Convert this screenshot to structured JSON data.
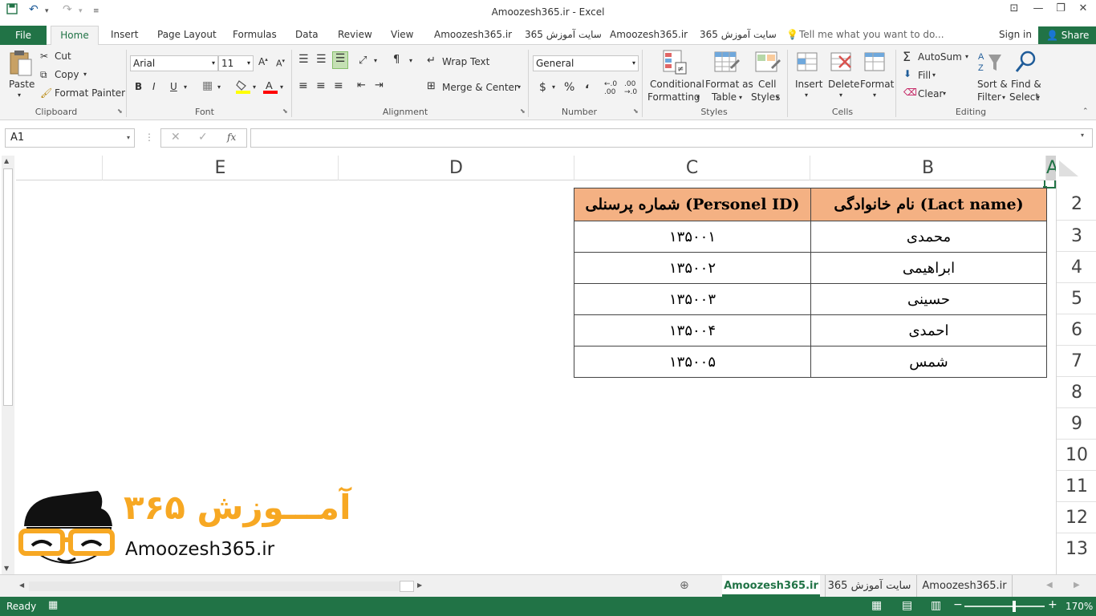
{
  "window": {
    "title": "Amoozesh365.ir - Excel"
  },
  "tabs": {
    "file": "File",
    "home": "Home",
    "insert": "Insert",
    "page_layout": "Page Layout",
    "formulas": "Formulas",
    "data": "Data",
    "review": "Review",
    "view": "View",
    "custom1": "Amoozesh365.ir",
    "custom2": "سایت آموزش 365",
    "custom3": "Amoozesh365.ir",
    "custom4": "سایت آموزش 365",
    "tell_me": "Tell me what you want to do...",
    "sign_in": "Sign in",
    "share": "Share"
  },
  "ribbon": {
    "clipboard": {
      "paste": "Paste",
      "cut": "Cut",
      "copy": "Copy",
      "format_painter": "Format Painter",
      "group": "Clipboard"
    },
    "font": {
      "name": "Arial",
      "size": "11",
      "bold": "B",
      "italic": "I",
      "underline": "U",
      "group": "Font"
    },
    "alignment": {
      "wrap_text": "Wrap Text",
      "merge_center": "Merge & Center",
      "group": "Alignment"
    },
    "number": {
      "format": "General",
      "currency": "$",
      "percent": "%",
      "comma": "،",
      "group": "Number"
    },
    "styles": {
      "conditional": "Conditional",
      "formatting": "Formatting",
      "format_as": "Format as",
      "table": "Table",
      "cell": "Cell",
      "styles": "Styles",
      "group": "Styles"
    },
    "cells": {
      "insert": "Insert",
      "delete": "Delete",
      "format": "Format",
      "group": "Cells"
    },
    "editing": {
      "autosum": "AutoSum",
      "fill": "Fill",
      "clear": "Clear",
      "sort": "Sort &",
      "filter": "Filter",
      "find": "Find &",
      "select": "Select",
      "group": "Editing"
    }
  },
  "formula_bar": {
    "name_box": "A1",
    "fx": "fx",
    "value": ""
  },
  "grid": {
    "columns": [
      "E",
      "D",
      "C",
      "B",
      "A"
    ],
    "rows": [
      "2",
      "3",
      "4",
      "5",
      "6",
      "7",
      "8",
      "9",
      "10",
      "11",
      "12",
      "13"
    ]
  },
  "table": {
    "headers": [
      "(Personel ID) شماره پرسنلی",
      "(Lact name) نام خانوادگی"
    ],
    "rows": [
      [
        "۱۳۵۰۰۱",
        "محمدی"
      ],
      [
        "۱۳۵۰۰۲",
        "ابراهیمی"
      ],
      [
        "۱۳۵۰۰۳",
        "حسینی"
      ],
      [
        "۱۳۵۰۰۴",
        "احمدی"
      ],
      [
        "۱۳۵۰۰۵",
        "شمس"
      ]
    ]
  },
  "logo": {
    "farsi": "آمـــوزش ۳۶۵",
    "url": "Amoozesh365.ir"
  },
  "sheets": [
    "Amoozesh365.ir",
    "سایت آموزش 365",
    "Amoozesh365.ir"
  ],
  "status": {
    "ready": "Ready",
    "zoom": "170%"
  },
  "colors": {
    "excel_green": "#217346",
    "header_fill": "#f4b183",
    "logo_orange": "#f7a823"
  }
}
